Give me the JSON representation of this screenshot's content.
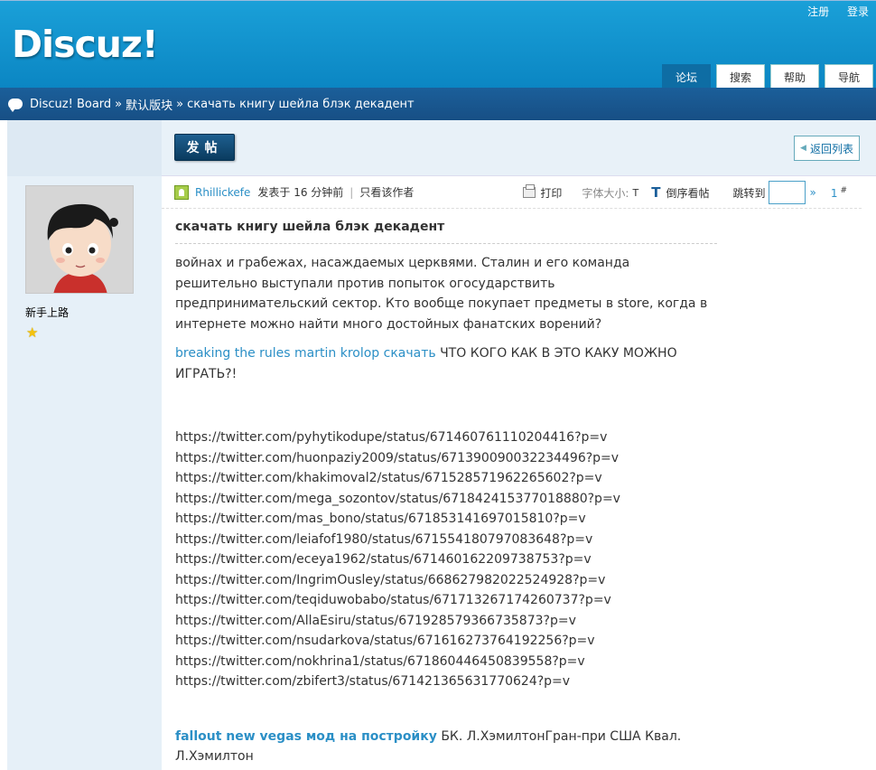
{
  "header": {
    "logo": "Discuz!",
    "toplinks": [
      "注册",
      "登录"
    ],
    "tabs": [
      {
        "label": "论坛",
        "active": true
      },
      {
        "label": "搜索",
        "active": false
      },
      {
        "label": "帮助",
        "active": false
      },
      {
        "label": "导航",
        "active": false
      }
    ]
  },
  "breadcrumb": {
    "home": "Discuz! Board",
    "sep": "»",
    "forum": "默认版块",
    "thread": "скачать книгу шейла блэк декадент"
  },
  "sidebar": {
    "rank": "新手上路"
  },
  "toolbar": {
    "post_label": "发帖",
    "back_label": "返回列表"
  },
  "meta": {
    "author": "Rhillickefe",
    "posted": "发表于 16 分钟前",
    "only_author": "只看该作者",
    "print": "打印",
    "font_size_label": "字体大小:",
    "font_size_t": "T",
    "reverse": "倒序看帖",
    "jump_label": "跳转到",
    "jump_arrow": "»",
    "floor": "1",
    "floor_mark": "#"
  },
  "post": {
    "title": "скачать книгу шейла блэк декадент",
    "p1": "войнах и грабежах, насаждаемых церквями. Сталин и его команда решительно выступали против попыток огосударствить предпринимательский сектор. Кто вообще покупает предметы в store, когда в интернете можно найти много достойных фанатских ворений?",
    "p2_link": "breaking the rules martin krolop скачать",
    "p2_text": " ЧТО КОГО КАК В ЭТО КАКУ МОЖНО ИГРАТЬ?!",
    "urls": [
      "https://twitter.com/pyhytikodupe/status/671460761110204416?p=v",
      "https://twitter.com/huonpaziy2009/status/671390090032234496?p=v",
      "https://twitter.com/khakimoval2/status/671528571962265602?p=v",
      "https://twitter.com/mega_sozontov/status/671842415377018880?p=v",
      "https://twitter.com/mas_bono/status/671853141697015810?p=v",
      "https://twitter.com/leiafof1980/status/671554180797083648?p=v",
      "https://twitter.com/eceya1962/status/671460162209738753?p=v",
      "https://twitter.com/IngrimOusley/status/668627982022524928?p=v",
      "https://twitter.com/teqiduwobabo/status/671713267174260737?p=v",
      "https://twitter.com/AllaEsiru/status/671928579366735873?p=v",
      "https://twitter.com/nsudarkova/status/671616273764192256?p=v",
      "https://twitter.com/nokhrina1/status/671860446450839558?p=v",
      "https://twitter.com/zbifert3/status/671421365631770624?p=v"
    ],
    "p3_link": "fallout new vegas мод на постройку",
    "p3_text": " БК. Л.ХэмилтонГран-при США Квал. Л.Хэмилтон"
  }
}
